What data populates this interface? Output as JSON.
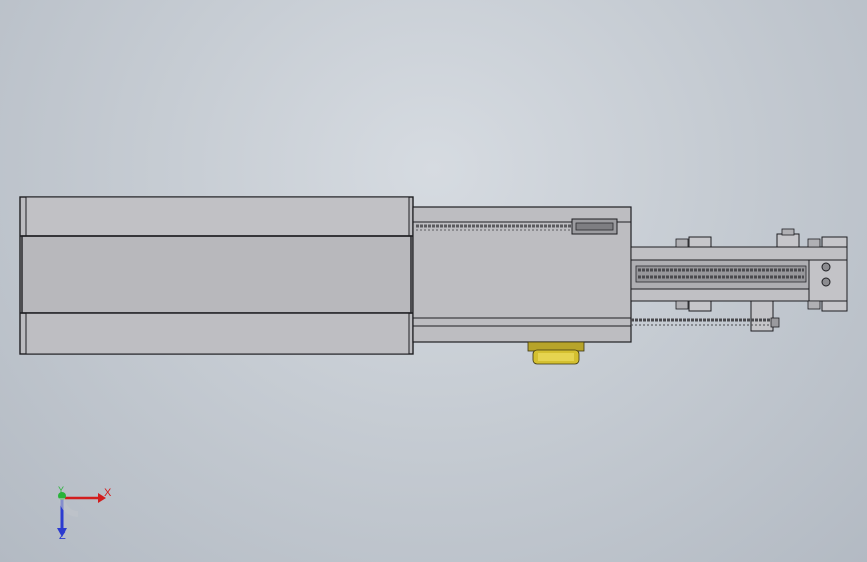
{
  "viewport": {
    "background_top": "#d6dbe1",
    "background_bottom": "#b3bac3"
  },
  "model": {
    "body_color": "#b9b9bd",
    "edge_color": "#1e1e22",
    "motor_color": "#d4c030",
    "chain_color": "#6a6a6e"
  },
  "triad": {
    "x_label": "X",
    "y_label": "Y",
    "z_label": "Z",
    "x_color": "#d21d1d",
    "y_color": "#29b33a",
    "z_color": "#2b3bd0"
  }
}
